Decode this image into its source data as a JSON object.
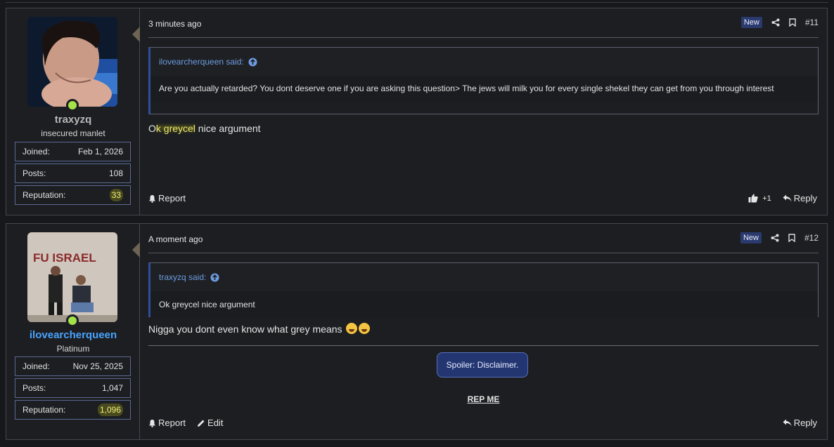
{
  "posts": [
    {
      "username": "traxyzq",
      "user_title": "insecured manlet",
      "stats": [
        {
          "label": "Joined:",
          "value": "Feb 1, 2026"
        },
        {
          "label": "Posts:",
          "value": "108"
        },
        {
          "label": "Reputation:",
          "value": "33"
        }
      ],
      "time": "3 minutes ago",
      "badge": "New",
      "post_number": "#11",
      "quote": {
        "author": "ilovearcherqueen said:",
        "text": "Are you actually retarded? You dont deserve one if you are asking this question> The jews will milk you for every single shekel they can get from you through interest"
      },
      "message_prefix": "O",
      "message_highlight": "k greycel",
      "message_rest": " nice argument",
      "report_label": "Report",
      "like_count": "+1",
      "reply_label": "Reply"
    },
    {
      "username": "ilovearcherqueen",
      "user_title": "Platinum",
      "stats": [
        {
          "label": "Joined:",
          "value": "Nov 25, 2025"
        },
        {
          "label": "Posts:",
          "value": "1,047"
        },
        {
          "label": "Reputation:",
          "value": "1,096"
        }
      ],
      "time": "A moment ago",
      "badge": "New",
      "post_number": "#12",
      "quote": {
        "author": "traxyzq said:",
        "text": "Ok greycel nice argument"
      },
      "message": "Nigga you dont even know what grey means",
      "spoiler_label": "Spoiler: Disclaimer.",
      "signature_link": "REP ME",
      "report_label": "Report",
      "edit_label": "Edit",
      "reply_label": "Reply"
    }
  ],
  "colors": {
    "background": "#16181b",
    "panel": "#1c1e21",
    "border": "#44474c",
    "online": "#a4e24a",
    "link_blue": "#4aa3ff",
    "badge_new": "#2b3a6e",
    "highlight": "#f2f07a"
  }
}
